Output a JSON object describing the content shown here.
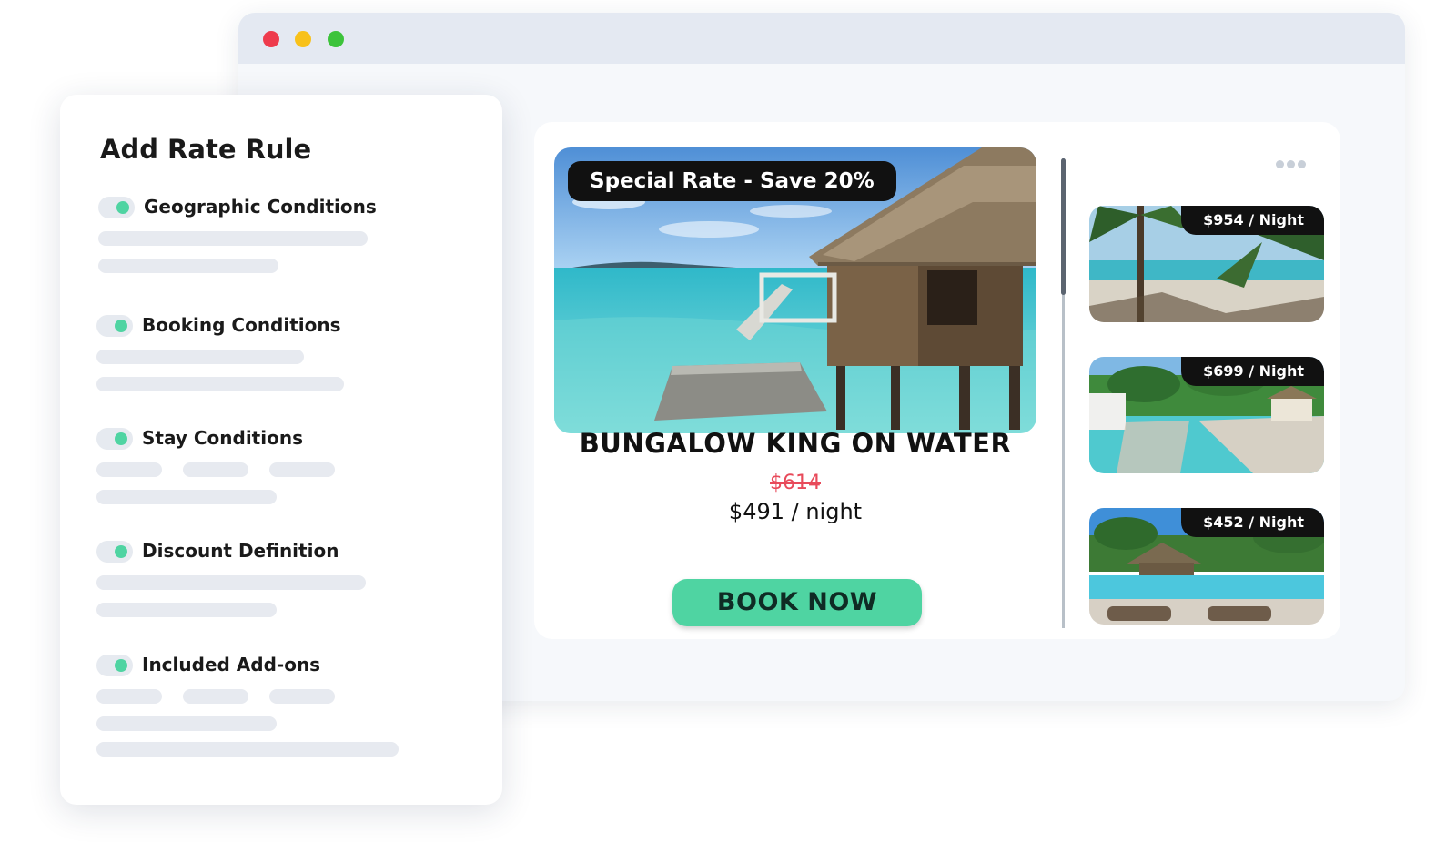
{
  "window": {
    "controls": [
      "close",
      "minimize",
      "maximize"
    ],
    "colors": {
      "close": "#ee3b4d",
      "minimize": "#f8c11a",
      "maximize": "#3cc33b"
    }
  },
  "rule_panel": {
    "title": "Add Rate Rule",
    "sections": [
      {
        "label": "Geographic Conditions",
        "enabled": true
      },
      {
        "label": "Booking Conditions",
        "enabled": true
      },
      {
        "label": "Stay Conditions",
        "enabled": true
      },
      {
        "label": "Discount Definition",
        "enabled": true
      },
      {
        "label": "Included Add-ons",
        "enabled": true
      }
    ],
    "toggle_color": "#4fd4a2"
  },
  "featured": {
    "badge": "Special Rate - Save 20%",
    "title": "BUNGALOW KING ON WATER",
    "old_price": "$614",
    "new_price": "$491 / night",
    "cta": "BOOK NOW",
    "cta_color": "#4fd4a2",
    "old_price_color": "#e84a5a",
    "image": "overwater-bungalow-photo"
  },
  "thumbnails": [
    {
      "price": "$954 / Night",
      "image": "palm-beach-photo"
    },
    {
      "price": "$699 / Night",
      "image": "resort-pier-photo"
    },
    {
      "price": "$452 / Night",
      "image": "resort-pool-photo"
    }
  ],
  "icons": {
    "more": "more-horizontal-icon"
  }
}
